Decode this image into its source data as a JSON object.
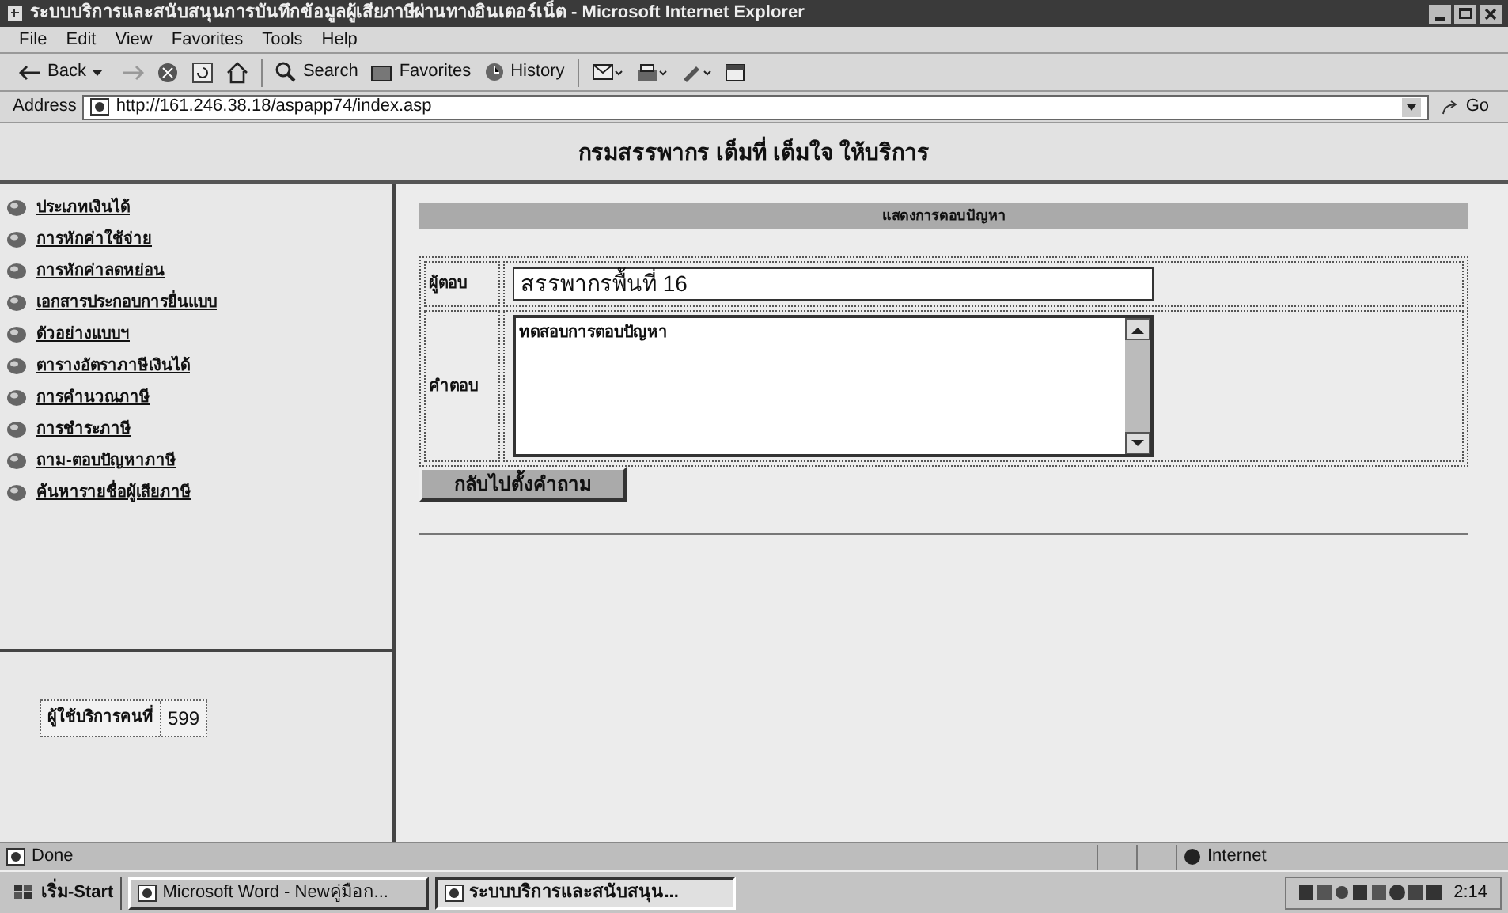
{
  "window": {
    "title": "ระบบบริการและสนับสนุนการบันทึกข้อมูลผู้เสียภาษีผ่านทางอินเตอร์เน็ต - Microsoft Internet Explorer"
  },
  "menu": [
    "File",
    "Edit",
    "View",
    "Favorites",
    "Tools",
    "Help"
  ],
  "toolbar": {
    "back": "Back",
    "search": "Search",
    "favorites": "Favorites",
    "history": "History"
  },
  "address": {
    "label": "Address",
    "url": "http://161.246.38.18/aspapp74/index.asp",
    "go": "Go"
  },
  "page": {
    "banner": "กรมสรรพากร เต็มที่ เต็มใจ ให้บริการ",
    "sidebar": {
      "items": [
        "ประเภทเงินได้",
        "การหักค่าใช้จ่าย",
        "การหักค่าลดหย่อน",
        "เอกสารประกอบการยื่นแบบ",
        "ตัวอย่างแบบฯ",
        "ตารางอัตราภาษีเงินได้",
        "การคำนวณภาษี",
        "การชำระภาษี",
        "ถาม-ตอบปัญหาภาษี",
        "ค้นหารายชื่อผู้เสียภาษี"
      ],
      "counter": {
        "label": "ผู้ใช้บริการคนที่",
        "value": "599"
      }
    },
    "panel": {
      "heading": "แสดงการตอบปัญหา",
      "responder_label": "ผู้ตอบ",
      "responder": "สรรพากรพื้นที่ 16",
      "answer_label": "คำตอบ",
      "answer": "ทดสอบการตอบปัญหา",
      "button": "กลับไปตั้งคำถาม"
    }
  },
  "status_bar": {
    "text": "Done",
    "zone": "Internet"
  },
  "taskbar": {
    "start": "เริ่ม-Start",
    "tasks": [
      {
        "label": "Microsoft Word - Newคู่มือก...",
        "selected": false
      },
      {
        "label": "ระบบบริการและสนับสนุน...",
        "selected": true
      }
    ],
    "clock": "2:14"
  }
}
